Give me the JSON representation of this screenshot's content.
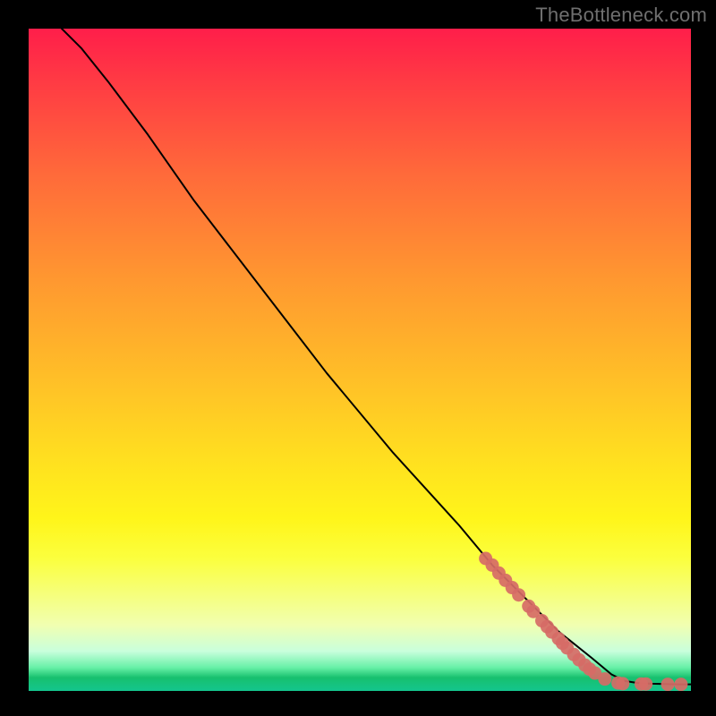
{
  "watermark": "TheBottleneck.com",
  "chart_data": {
    "type": "line",
    "title": "",
    "xlabel": "",
    "ylabel": "",
    "xlim": [
      0,
      100
    ],
    "ylim": [
      0,
      100
    ],
    "grid": false,
    "legend": false,
    "curve": [
      {
        "x": 5,
        "y": 100
      },
      {
        "x": 8,
        "y": 97
      },
      {
        "x": 12,
        "y": 92
      },
      {
        "x": 18,
        "y": 84
      },
      {
        "x": 25,
        "y": 74
      },
      {
        "x": 35,
        "y": 61
      },
      {
        "x": 45,
        "y": 48
      },
      {
        "x": 55,
        "y": 36
      },
      {
        "x": 65,
        "y": 25
      },
      {
        "x": 70,
        "y": 19
      },
      {
        "x": 75,
        "y": 14
      },
      {
        "x": 80,
        "y": 9
      },
      {
        "x": 85,
        "y": 5
      },
      {
        "x": 88,
        "y": 2.5
      },
      {
        "x": 90,
        "y": 1.5
      },
      {
        "x": 92,
        "y": 1.2
      },
      {
        "x": 94,
        "y": 1.1
      },
      {
        "x": 96,
        "y": 1.05
      },
      {
        "x": 98,
        "y": 1.0
      },
      {
        "x": 100,
        "y": 1.0
      }
    ],
    "highlight_points": [
      {
        "x": 69,
        "y": 20.0
      },
      {
        "x": 70,
        "y": 19.0
      },
      {
        "x": 71,
        "y": 17.8
      },
      {
        "x": 72,
        "y": 16.7
      },
      {
        "x": 73,
        "y": 15.6
      },
      {
        "x": 74,
        "y": 14.5
      },
      {
        "x": 75.5,
        "y": 12.8
      },
      {
        "x": 76.2,
        "y": 12.0
      },
      {
        "x": 77.5,
        "y": 10.6
      },
      {
        "x": 78.3,
        "y": 9.7
      },
      {
        "x": 79.0,
        "y": 8.9
      },
      {
        "x": 80.0,
        "y": 7.9
      },
      {
        "x": 80.6,
        "y": 7.2
      },
      {
        "x": 81.3,
        "y": 6.5
      },
      {
        "x": 82.3,
        "y": 5.5
      },
      {
        "x": 83.1,
        "y": 4.7
      },
      {
        "x": 84.0,
        "y": 3.9
      },
      {
        "x": 84.7,
        "y": 3.3
      },
      {
        "x": 85.5,
        "y": 2.7
      },
      {
        "x": 87.0,
        "y": 1.8
      },
      {
        "x": 89.0,
        "y": 1.2
      },
      {
        "x": 89.7,
        "y": 1.1
      },
      {
        "x": 92.5,
        "y": 1.05
      },
      {
        "x": 93.2,
        "y": 1.05
      },
      {
        "x": 96.5,
        "y": 1.0
      },
      {
        "x": 98.5,
        "y": 1.0
      }
    ],
    "colors": {
      "curve": "#000000",
      "point_fill": "#d66b66",
      "gradient_top": "#ff1e4a",
      "gradient_mid": "#ffe21f",
      "gradient_bottom": "#14c58e"
    }
  }
}
